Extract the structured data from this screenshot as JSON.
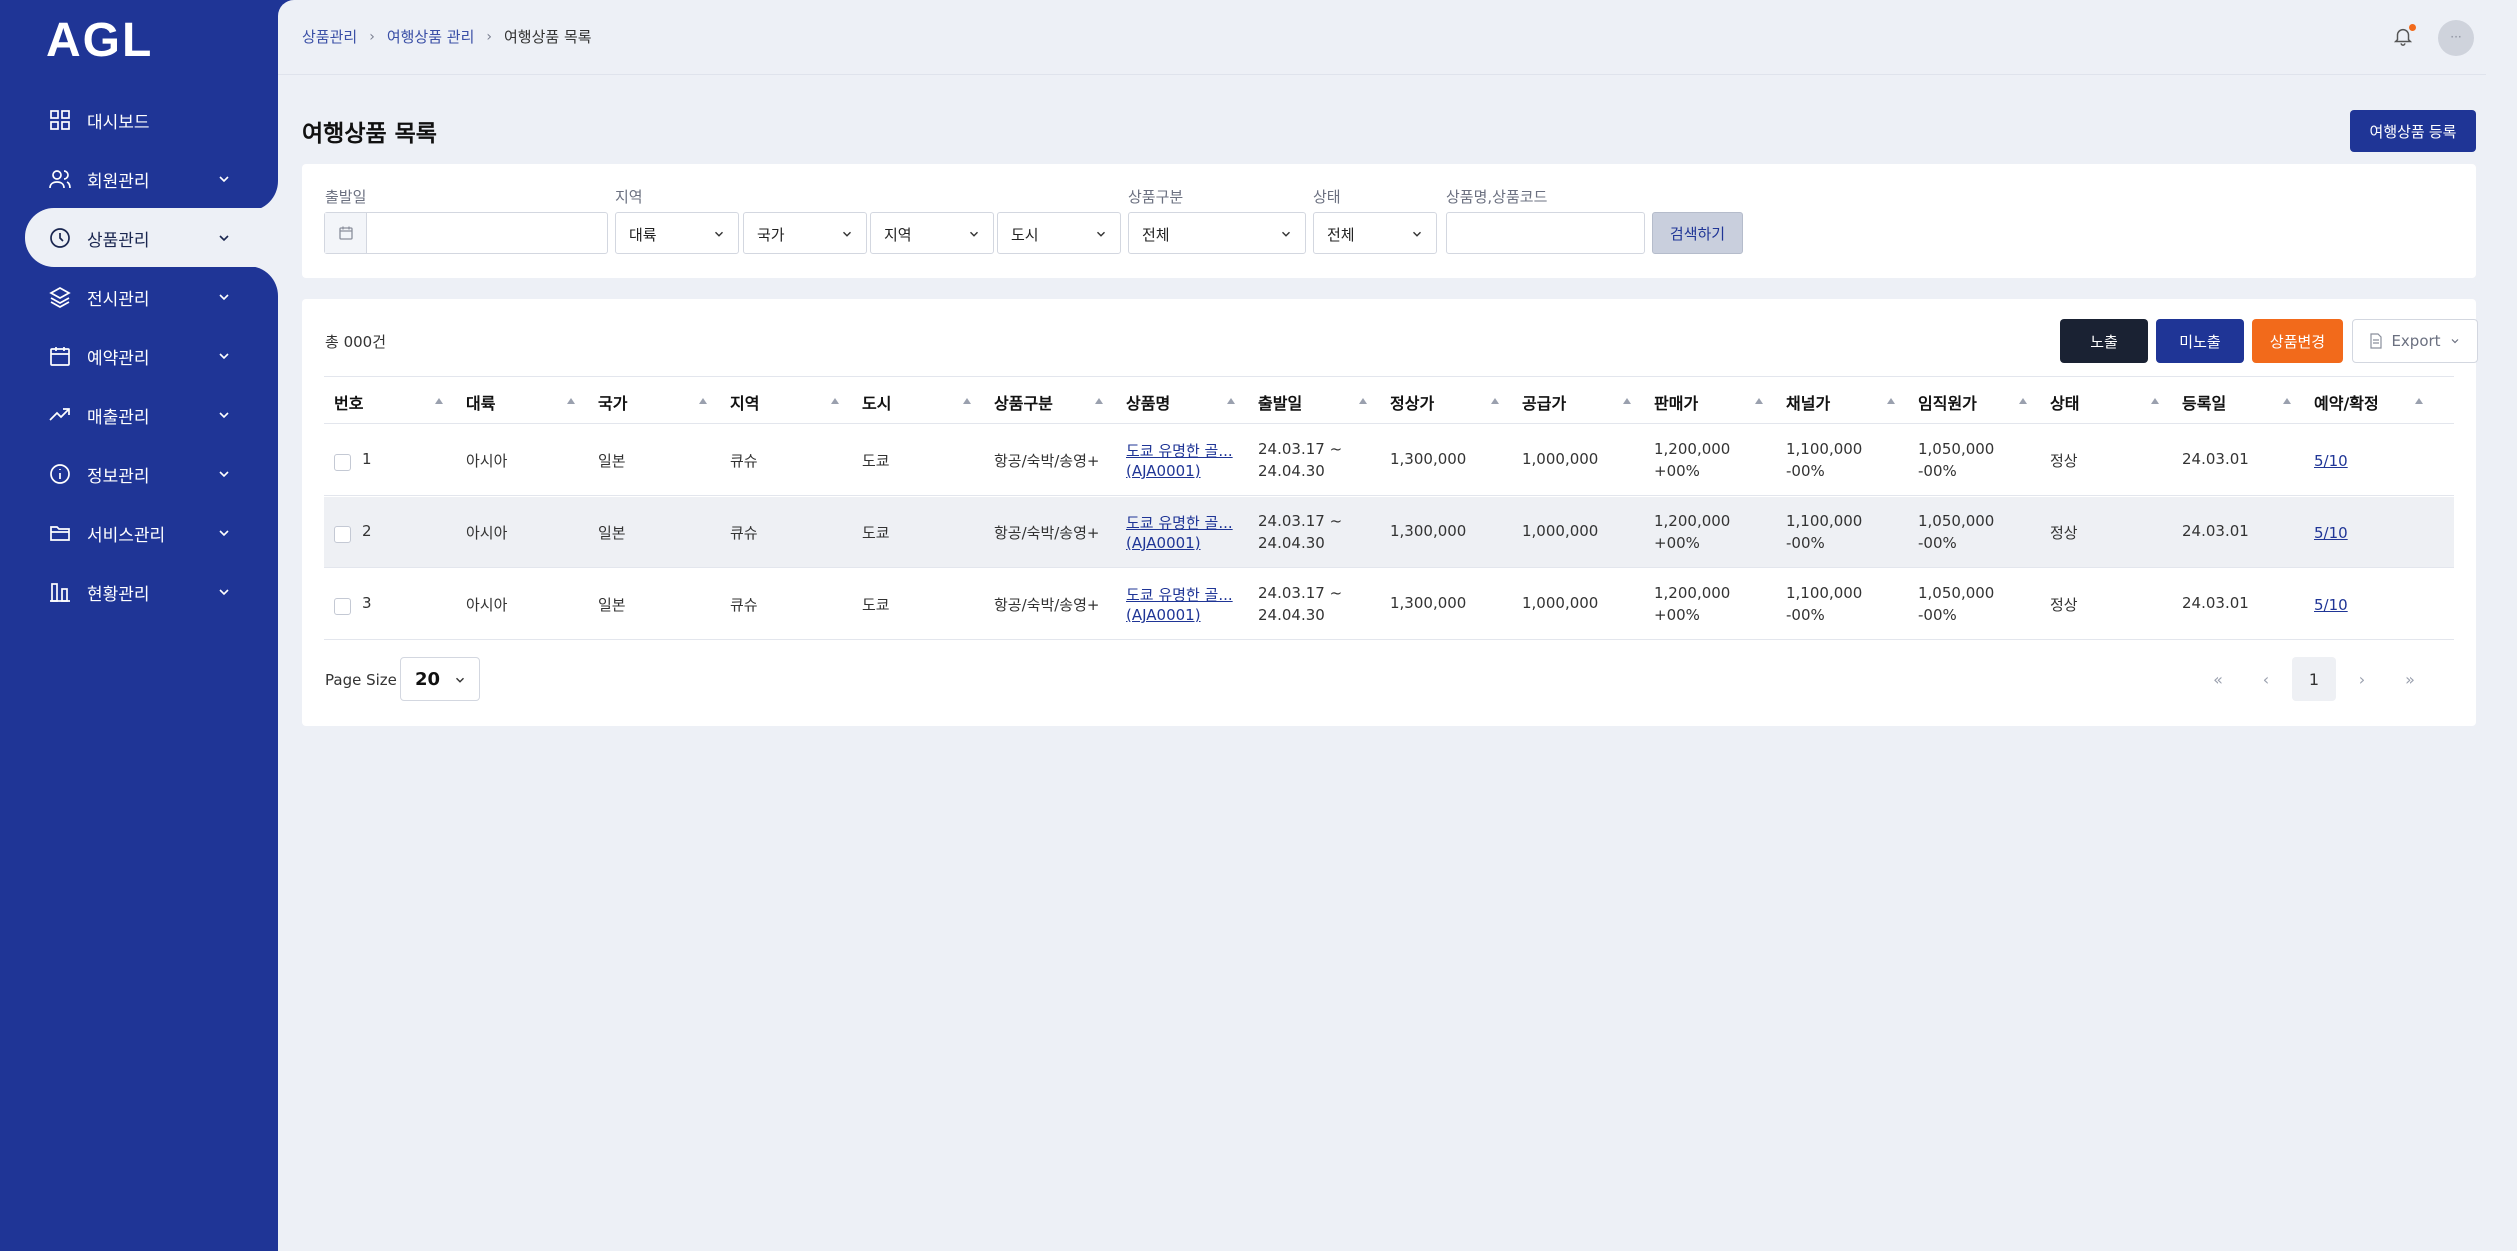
{
  "brand": {
    "logo_text": "AGL"
  },
  "sidebar": {
    "items": [
      {
        "label": "대시보드",
        "icon": "dashboard-icon",
        "has_chevron": false
      },
      {
        "label": "회원관리",
        "icon": "users-icon",
        "has_chevron": true
      },
      {
        "label": "상품관리",
        "icon": "clock-icon",
        "has_chevron": true,
        "active": true
      },
      {
        "label": "전시관리",
        "icon": "layers-icon",
        "has_chevron": true
      },
      {
        "label": "예약관리",
        "icon": "calendar-icon",
        "has_chevron": true
      },
      {
        "label": "매출관리",
        "icon": "trend-icon",
        "has_chevron": true
      },
      {
        "label": "정보관리",
        "icon": "info-icon",
        "has_chevron": true
      },
      {
        "label": "서비스관리",
        "icon": "folder-icon",
        "has_chevron": true
      },
      {
        "label": "현황관리",
        "icon": "chart-bars-icon",
        "has_chevron": true
      }
    ]
  },
  "header": {
    "breadcrumb": [
      "상품관리",
      "여행상품 관리",
      "여행상품 목록"
    ],
    "avatar_text": "···"
  },
  "page": {
    "title": "여행상품 목록",
    "register_button": "여행상품 등록"
  },
  "search": {
    "departure_label": "출발일",
    "region_label": "지역",
    "continent_select": "대륙",
    "country_select": "국가",
    "region_select": "지역",
    "city_select": "도시",
    "category_label": "상품구분",
    "category_select": "전체",
    "status_label": "상태",
    "status_select": "전체",
    "keyword_label": "상품명,상품코드",
    "search_button": "검색하기"
  },
  "list": {
    "total": "총 000건",
    "show_button": "노출",
    "hide_button": "미노출",
    "change_button": "상품변경",
    "export_button": "Export",
    "columns": [
      "번호",
      "대륙",
      "국가",
      "지역",
      "도시",
      "상품구분",
      "상품명",
      "출발일",
      "정상가",
      "공급가",
      "판매가",
      "채널가",
      "임직원가",
      "상태",
      "등록일",
      "예약/확정"
    ],
    "rows": [
      {
        "no": "1",
        "continent": "아시아",
        "country": "일본",
        "region": "큐슈",
        "city": "도쿄",
        "category": "항공/숙박/송영+",
        "name": "도쿄 유명한 골...",
        "code": "(AJA0001)",
        "dep_from": "24.03.17 ~",
        "dep_to": "24.04.30",
        "regular": "1,300,000",
        "supply": "1,000,000",
        "sale": "1,200,000",
        "sale_rate": "+00%",
        "channel": "1,100,000",
        "channel_rate": "-00%",
        "staff": "1,050,000",
        "staff_rate": "-00%",
        "status": "정상",
        "reg_date": "24.03.01",
        "booking": "5/10"
      },
      {
        "no": "2",
        "continent": "아시아",
        "country": "일본",
        "region": "큐슈",
        "city": "도쿄",
        "category": "항공/숙박/송영+",
        "name": "도쿄 유명한 골...",
        "code": "(AJA0001)",
        "dep_from": "24.03.17 ~",
        "dep_to": "24.04.30",
        "regular": "1,300,000",
        "supply": "1,000,000",
        "sale": "1,200,000",
        "sale_rate": "+00%",
        "channel": "1,100,000",
        "channel_rate": "-00%",
        "staff": "1,050,000",
        "staff_rate": "-00%",
        "status": "정상",
        "reg_date": "24.03.01",
        "booking": "5/10"
      },
      {
        "no": "3",
        "continent": "아시아",
        "country": "일본",
        "region": "큐슈",
        "city": "도쿄",
        "category": "항공/숙박/송영+",
        "name": "도쿄 유명한 골...",
        "code": "(AJA0001)",
        "dep_from": "24.03.17 ~",
        "dep_to": "24.04.30",
        "regular": "1,300,000",
        "supply": "1,000,000",
        "sale": "1,200,000",
        "sale_rate": "+00%",
        "channel": "1,100,000",
        "channel_rate": "-00%",
        "staff": "1,050,000",
        "staff_rate": "-00%",
        "status": "정상",
        "reg_date": "24.03.01",
        "booking": "5/10"
      }
    ],
    "page_size_label": "Page Size",
    "page_size": "20",
    "current_page": "1"
  },
  "colors": {
    "primary": "#1f3596",
    "dark": "#1a2233",
    "orange": "#f26a1b",
    "background": "#edf0f6"
  }
}
